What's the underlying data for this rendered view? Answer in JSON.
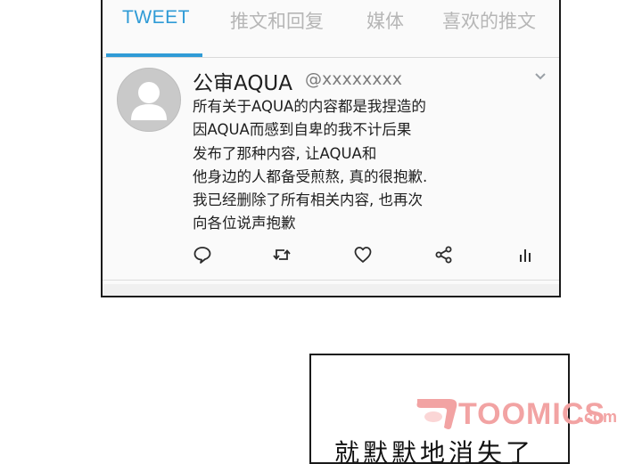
{
  "tabs": [
    {
      "label": "TWEET",
      "active": true
    },
    {
      "label": "推文和回复",
      "active": false
    },
    {
      "label": "媒体",
      "active": false
    },
    {
      "label": "喜欢的推文",
      "active": false
    }
  ],
  "tweet": {
    "display_name": "公审AQUA",
    "handle": "@xxxxxxxx",
    "lines": [
      "所有关于AQUA的内容都是我捏造的",
      "因AQUA而感到自卑的我不计后果",
      "发布了那种内容, 让AQUA和",
      "他身边的人都备受煎熬, 真的很抱歉.",
      "我已经删除了所有相关内容, 也再次",
      "向各位说声抱歉"
    ],
    "actions": [
      "reply-icon",
      "retweet-icon",
      "like-icon",
      "share-icon",
      "analytics-icon"
    ]
  },
  "panel2": {
    "text": "就默默地消失了"
  },
  "watermark": {
    "text": "TOOMICS",
    "suffix": ".com"
  },
  "colors": {
    "accent": "#2f9bd6",
    "inactive_tab": "#b6b6b6",
    "watermark": "#f2a3a3"
  }
}
